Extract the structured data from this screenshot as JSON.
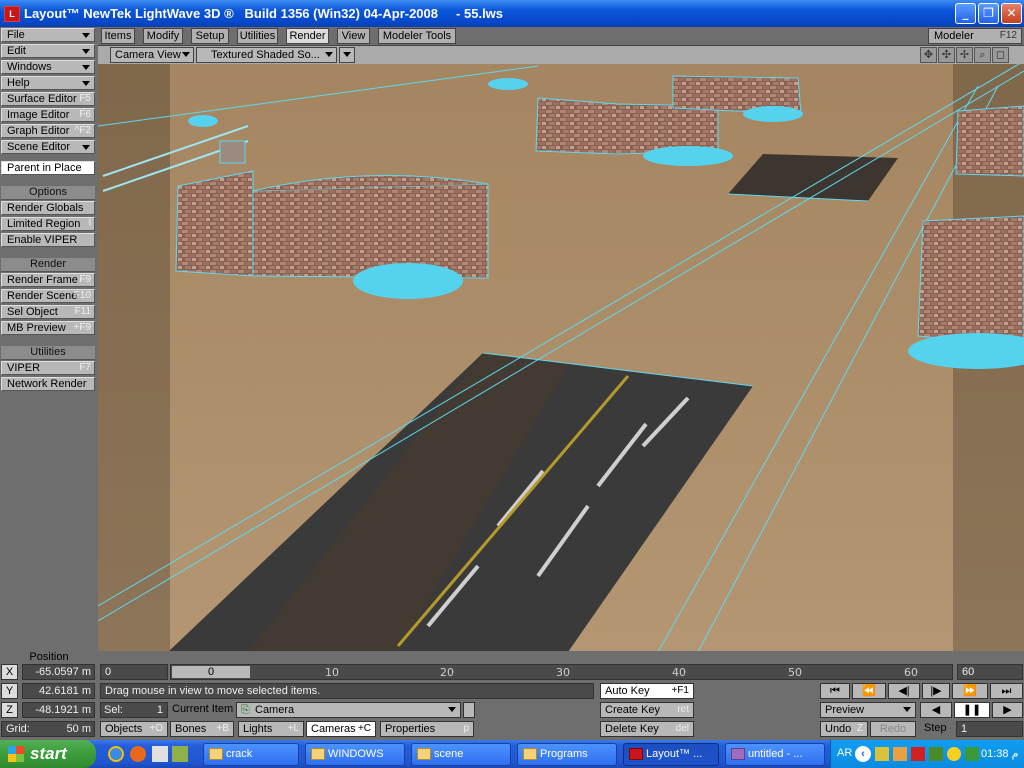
{
  "window": {
    "title": "Layout™ NewTek LightWave 3D ®   Build 1356 (Win32) 04-Apr-2008     - 55.lws",
    "min": "_",
    "max": "❐",
    "close": "✕"
  },
  "left_menu": {
    "file": "File",
    "edit": "Edit",
    "windows": "Windows",
    "help": "Help",
    "surface_editor": {
      "label": "Surface Editor",
      "key": "F5"
    },
    "image_editor": {
      "label": "Image Editor",
      "key": "F6"
    },
    "graph_editor": {
      "label": "Graph Editor",
      "key": "^F2"
    },
    "scene_editor": {
      "label": "Scene Editor"
    },
    "parent_in_place": "Parent in Place",
    "options_head": "Options",
    "render_globals": "Render Globals",
    "limited_region": {
      "label": "Limited Region",
      "key": "l"
    },
    "enable_viper": "Enable VIPER",
    "render_head": "Render",
    "render_frame": {
      "label": "Render Frame",
      "key": "F9"
    },
    "render_scene": {
      "label": "Render Scene",
      "key": "F10"
    },
    "sel_object": {
      "label": "Sel Object",
      "key": "F11"
    },
    "mb_preview": {
      "label": "MB Preview",
      "key": "+F9"
    },
    "utilities_head": "Utilities",
    "viper": {
      "label": "VIPER",
      "key": "F7"
    },
    "network_render": "Network Render"
  },
  "tabs": [
    "Items",
    "Modify",
    "Setup",
    "Utilities",
    "Render",
    "View",
    "Modeler Tools"
  ],
  "active_tab": "Render",
  "modeler": {
    "label": "Modeler",
    "key": "F12"
  },
  "viewport": {
    "view": "Camera View",
    "shading": "Textured Shaded So..."
  },
  "position": {
    "label": "Position",
    "x_label": "X",
    "x": "-65.0597 m",
    "y_label": "Y",
    "y": "42.6181 m",
    "z_label": "Z",
    "z": "-48.1921 m",
    "grid_label": "Grid:",
    "grid": "50 m"
  },
  "timeline": {
    "start": "0",
    "end": "60",
    "current": "0",
    "ticks": [
      "0",
      "10",
      "20",
      "30",
      "40",
      "50",
      "60"
    ]
  },
  "status": "Drag mouse in view to move selected items.",
  "sel": {
    "label": "Sel:",
    "value": "1"
  },
  "current_item": {
    "label": "Current Item",
    "value": "Camera"
  },
  "item_buttons": {
    "objects": {
      "label": "Objects",
      "key": "+O"
    },
    "bones": {
      "label": "Bones",
      "key": "+B"
    },
    "lights": {
      "label": "Lights",
      "key": "+L"
    },
    "cameras": {
      "label": "Cameras",
      "key": "+C"
    },
    "properties": {
      "label": "Properties",
      "key": "p"
    }
  },
  "keys": {
    "auto_key": {
      "label": "Auto Key",
      "key": "+F1"
    },
    "create_key": {
      "label": "Create Key",
      "key": "ret"
    },
    "delete_key": {
      "label": "Delete Key",
      "key": "del"
    }
  },
  "transport": {
    "preview": "Preview",
    "undo": {
      "label": "Undo",
      "key": "Z"
    },
    "redo": "Redo",
    "step_label": "Step",
    "step": "1"
  },
  "taskbar": {
    "start": "start",
    "tasks": [
      "crack",
      "WINDOWS",
      "scene",
      "Programs",
      "Layout™ ...",
      "untitled - ..."
    ],
    "lang": "AR",
    "clock": "01:38 م"
  },
  "colors": {
    "xp_blue": "#0a55d8",
    "lw_panel": "#6e6e6e",
    "lw_button": "#b8b8b8",
    "wire": "#5fd8f0",
    "ground": "#b0906a"
  }
}
